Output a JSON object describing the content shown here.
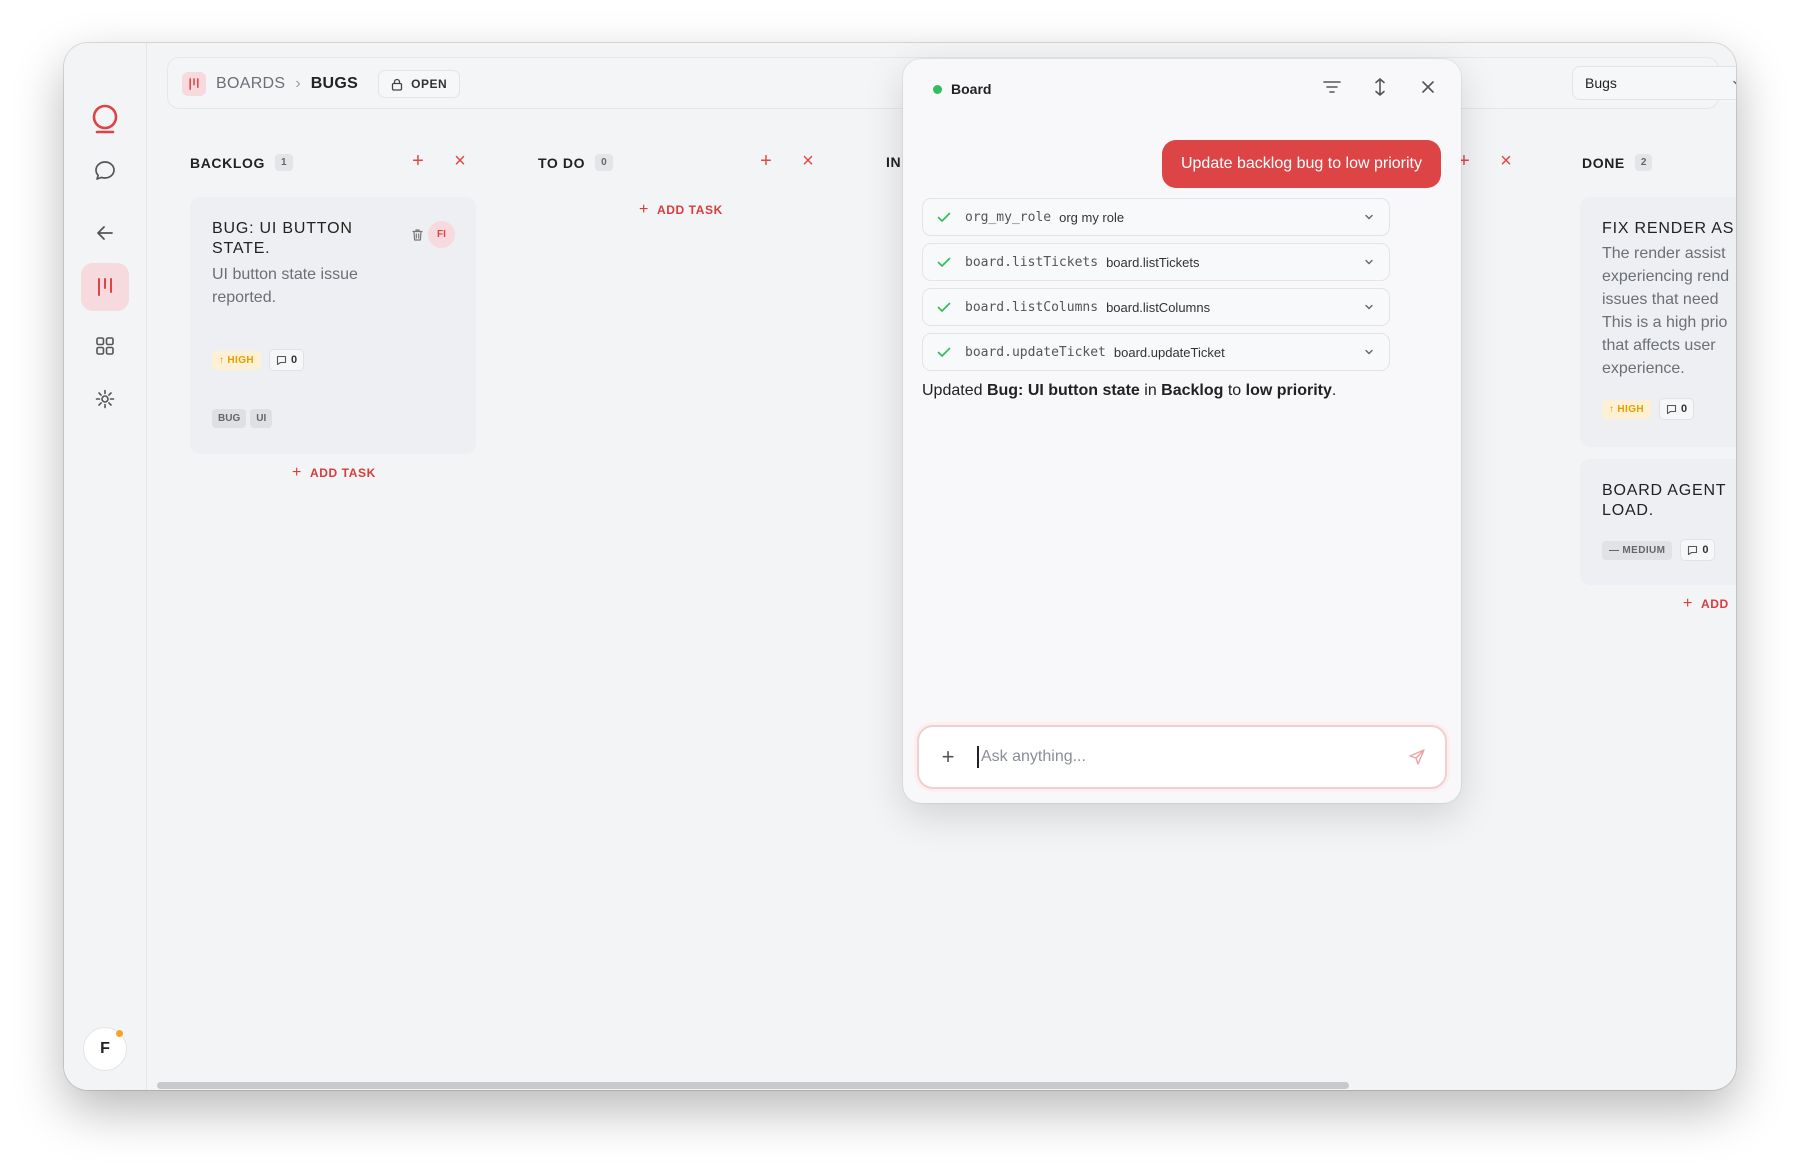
{
  "breadcrumb": {
    "boards": "BOARDS",
    "separator": "›",
    "current": "BUGS",
    "status": "OPEN"
  },
  "board_select": {
    "value": "Bugs"
  },
  "user": {
    "initial": "F"
  },
  "columns": [
    {
      "title": "BACKLOG",
      "count": "1"
    },
    {
      "title": "TO DO",
      "count": "0"
    },
    {
      "title": "IN",
      "count": ""
    },
    {
      "title": "DONE",
      "count": "2"
    }
  ],
  "add_task_label": "ADD TASK",
  "add_task_partial": "ADD",
  "cards": {
    "backlog": {
      "title": "BUG: UI BUTTON STATE.",
      "desc": "UI button state issue reported.",
      "assignee": "FI",
      "priority": "HIGH",
      "comments": "0",
      "tags": [
        "BUG",
        "UI"
      ]
    },
    "done1": {
      "title": "FIX RENDER AS",
      "desc_lines": [
        "The render assist",
        "experiencing rend",
        "issues that need",
        "This is a high prio",
        "that affects user",
        "experience."
      ],
      "priority": "HIGH",
      "comments": "0"
    },
    "done2": {
      "title_lines": [
        "BOARD AGENT",
        "LOAD."
      ],
      "priority": "MEDIUM",
      "comments": "0"
    }
  },
  "assistant": {
    "title": "Board",
    "status_color": "#2fbf5d",
    "user_message": "Update backlog bug to low priority",
    "tools": [
      {
        "code": "org_my_role",
        "label": "org my role"
      },
      {
        "code": "board.listTickets",
        "label": "board.listTickets"
      },
      {
        "code": "board.listColumns",
        "label": "board.listColumns"
      },
      {
        "code": "board.updateTicket",
        "label": "board.updateTicket"
      }
    ],
    "answer": {
      "prefix": "Updated ",
      "ticket": "Bug: UI button state",
      "mid1": " in ",
      "column": "Backlog",
      "mid2": " to ",
      "priority": "low priority",
      "suffix": "."
    },
    "input_placeholder": "Ask anything..."
  },
  "colors": {
    "accent": "#dc4446",
    "accent_soft": "#f6dadd",
    "high": "#e0a000"
  },
  "icons": [
    "logo-icon",
    "chat-icon",
    "back-arrow-icon",
    "board-icon",
    "grid-icon",
    "gear-icon",
    "lock-icon",
    "chevron-down-icon",
    "external-link-icon",
    "filter-icon",
    "expand-icon",
    "close-icon",
    "trash-icon",
    "check-icon",
    "comment-icon",
    "plus-icon",
    "send-icon"
  ]
}
